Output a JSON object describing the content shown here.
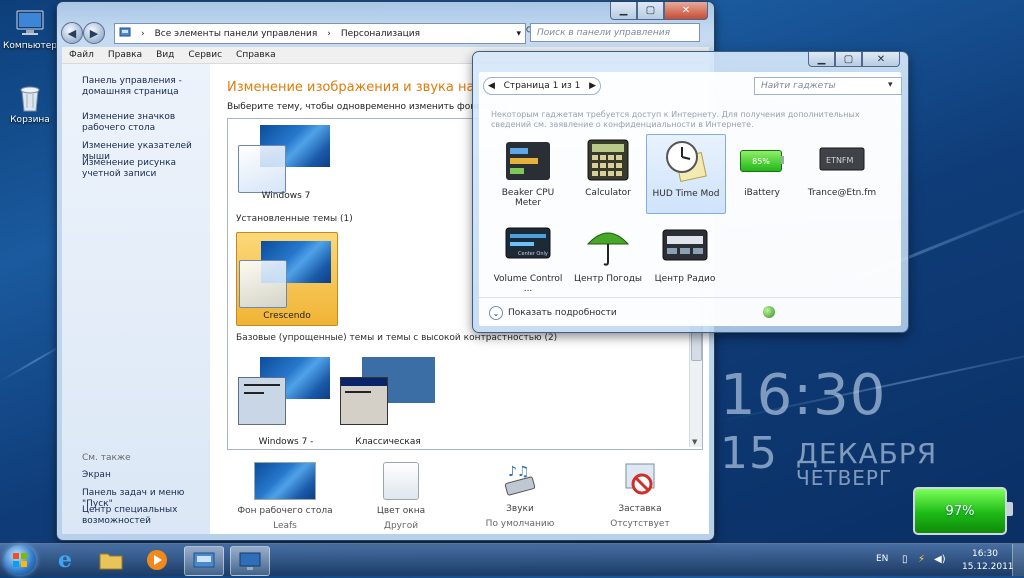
{
  "desktop": {
    "icons": [
      {
        "label": "Компьютер",
        "icon": "computer-icon"
      },
      {
        "label": "Корзина",
        "icon": "recycle-bin-icon"
      }
    ]
  },
  "explorer": {
    "address": [
      "Все элементы панели управления",
      "Персонализация"
    ],
    "search_placeholder": "Поиск в панели управления",
    "menu": [
      "Файл",
      "Правка",
      "Вид",
      "Сервис",
      "Справка"
    ],
    "sidebar": {
      "links": [
        "Панель управления - домашняя страница",
        "Изменение значков рабочего стола",
        "Изменение указателей мыши",
        "Изменение рисунка учетной записи"
      ],
      "see_also_label": "См. также",
      "see_also": [
        "Экран",
        "Панель задач и меню \"Пуск\"",
        "Центр специальных возможностей"
      ]
    },
    "heading": "Изменение изображения и звука на компьют",
    "subtext": "Выберите тему, чтобы одновременно изменить фоновый р",
    "themes": {
      "windows7": "Windows 7",
      "installed_label": "Установленные темы (1)",
      "crescendo": "Crescendo",
      "basic_label": "Базовые (упрощенные) темы и темы с высокой контрастностью (2)",
      "basic": [
        "Windows 7 -",
        "Классическая"
      ]
    },
    "bottom": [
      {
        "title": "Фон рабочего стола",
        "value": "Leafs",
        "icon": "desktop-background-icon"
      },
      {
        "title": "Цвет окна",
        "value": "Другой",
        "icon": "window-color-icon"
      },
      {
        "title": "Звуки",
        "value": "По умолчанию",
        "icon": "sounds-icon"
      },
      {
        "title": "Заставка",
        "value": "Отсутствует",
        "icon": "screensaver-icon"
      }
    ]
  },
  "gadgets": {
    "pager": "Страница 1 из 1",
    "search_placeholder": "Найти гаджеты",
    "note": "Некоторым гаджетам требуется доступ к Интернету. Для получения дополнительных сведений см. заявление о конфиденциальности в Интернете.",
    "items": [
      {
        "label": "Beaker CPU Meter",
        "icon": "cpu-meter-icon"
      },
      {
        "label": "Calculator",
        "icon": "calculator-icon"
      },
      {
        "label": "HUD Time Mod",
        "icon": "clock-icon"
      },
      {
        "label": "iBattery",
        "icon": "battery-icon"
      },
      {
        "label": "Trance@Etn.fm",
        "icon": "radio-icon"
      },
      {
        "label": "Volume Control ...",
        "icon": "volume-icon"
      },
      {
        "label": "Центр Погоды",
        "icon": "umbrella-icon"
      },
      {
        "label": "Центр Радио",
        "icon": "radio-center-icon"
      }
    ],
    "ibattery_text": "85%",
    "details_label": "Показать подробности"
  },
  "desktop_clock": {
    "time": "16:30",
    "day": "15",
    "month": "ДЕКАБРЯ",
    "weekday": "ЧЕТВЕРГ"
  },
  "battery_widget": "97%",
  "taskbar": {
    "lang": "EN",
    "time": "16:30",
    "date": "15.12.2011"
  },
  "colors": {
    "heading": "#e07b0a",
    "selected_theme": "#f6c54e",
    "battery": "#23c11a"
  }
}
